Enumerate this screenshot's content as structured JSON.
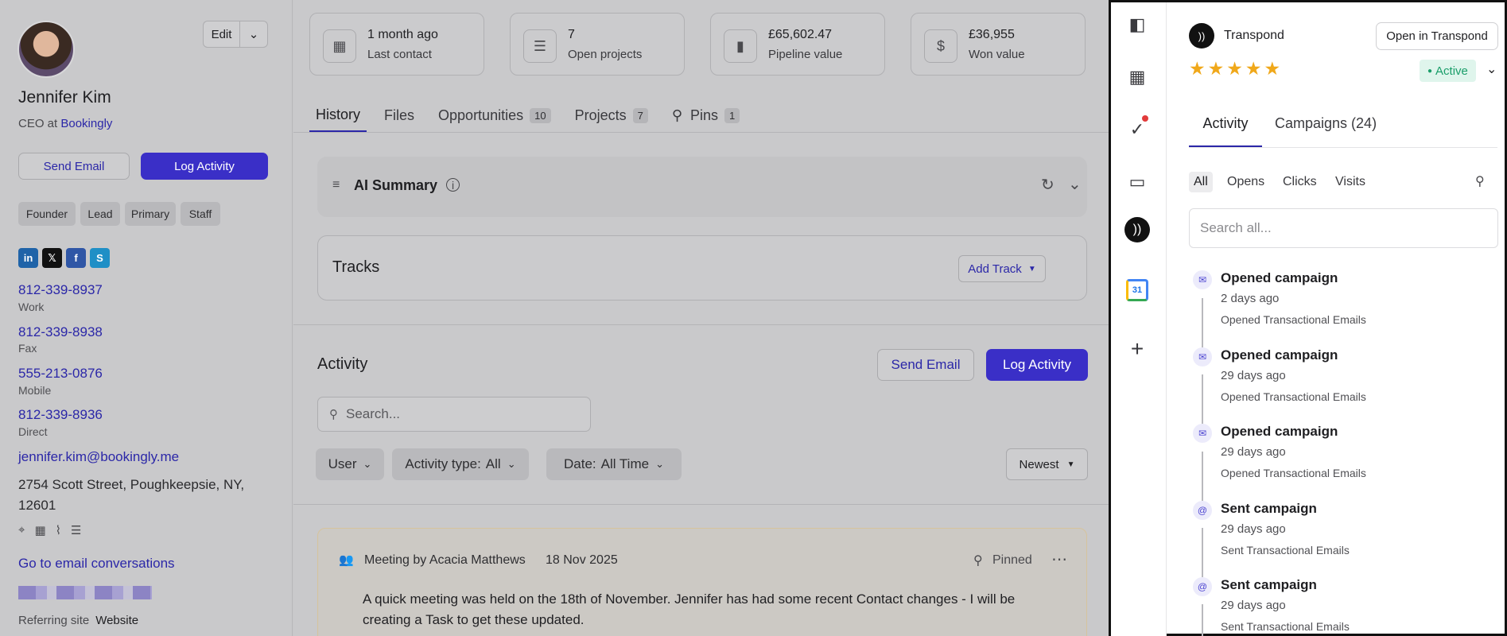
{
  "contact": {
    "name": "Jennifer Kim",
    "role_prefix": "CEO at",
    "company": "Bookingly",
    "edit_label": "Edit",
    "send_email": "Send Email",
    "log_activity": "Log Activity",
    "tags": [
      "Founder",
      "Lead",
      "Primary",
      "Staff"
    ],
    "phones": [
      {
        "number": "812-339-8937",
        "label": "Work"
      },
      {
        "number": "812-339-8938",
        "label": "Fax"
      },
      {
        "number": "555-213-0876",
        "label": "Mobile"
      },
      {
        "number": "812-339-8936",
        "label": "Direct"
      }
    ],
    "email": "jennifer.kim@bookingly.me",
    "address_line1": "2754 Scott Street, Poughkeepsie, NY,",
    "address_line2": "12601",
    "go_email": "Go to email conversations",
    "referring_label": "Referring site",
    "referring_value": "Website"
  },
  "stats": [
    {
      "value": "1 month ago",
      "label": "Last contact"
    },
    {
      "value": "7",
      "label": "Open projects"
    },
    {
      "value": "£65,602.47",
      "label": "Pipeline value"
    },
    {
      "value": "£36,955",
      "label": "Won value"
    }
  ],
  "tabs": [
    {
      "label": "History"
    },
    {
      "label": "Files"
    },
    {
      "label": "Opportunities",
      "count": "10"
    },
    {
      "label": "Projects",
      "count": "7"
    },
    {
      "label": "Pins",
      "count": "1"
    }
  ],
  "ai_summary": {
    "title": "AI Summary"
  },
  "tracks": {
    "title": "Tracks",
    "add": "Add Track"
  },
  "activity": {
    "title": "Activity",
    "send_email": "Send Email",
    "log_activity": "Log Activity",
    "search_placeholder": "Search...",
    "filters": {
      "user": "User",
      "type_label": "Activity type:",
      "type_value": "All",
      "date_label": "Date:",
      "date_value": "All Time"
    },
    "sort": "Newest",
    "meeting": {
      "header": "Meeting by Acacia Matthews",
      "date": "18 Nov 2025",
      "pinned": "Pinned",
      "line1": "A quick meeting was held on the 18th of November. Jennifer has had some recent Contact changes - I will be",
      "line2": "creating a Task to get these updated."
    }
  },
  "transpond": {
    "title": "Transpond",
    "open_btn": "Open in Transpond",
    "rating": 5,
    "status": "Active",
    "status_color": "#1a9e6a",
    "tabs": {
      "activity": "Activity",
      "campaigns": "Campaigns (24)"
    },
    "filters": [
      "All",
      "Opens",
      "Clicks",
      "Visits"
    ],
    "search_placeholder": "Search all...",
    "calendar_day": "31",
    "items": [
      {
        "title": "Opened campaign",
        "time": "2 days ago",
        "desc": "Opened Transactional Emails",
        "kind": "open"
      },
      {
        "title": "Opened campaign",
        "time": "29 days ago",
        "desc": "Opened Transactional Emails",
        "kind": "open"
      },
      {
        "title": "Opened campaign",
        "time": "29 days ago",
        "desc": "Opened Transactional Emails",
        "kind": "open"
      },
      {
        "title": "Sent campaign",
        "time": "29 days ago",
        "desc": "Sent Transactional Emails",
        "kind": "sent"
      },
      {
        "title": "Sent campaign",
        "time": "29 days ago",
        "desc": "Sent Transactional Emails",
        "kind": "sent"
      }
    ]
  }
}
